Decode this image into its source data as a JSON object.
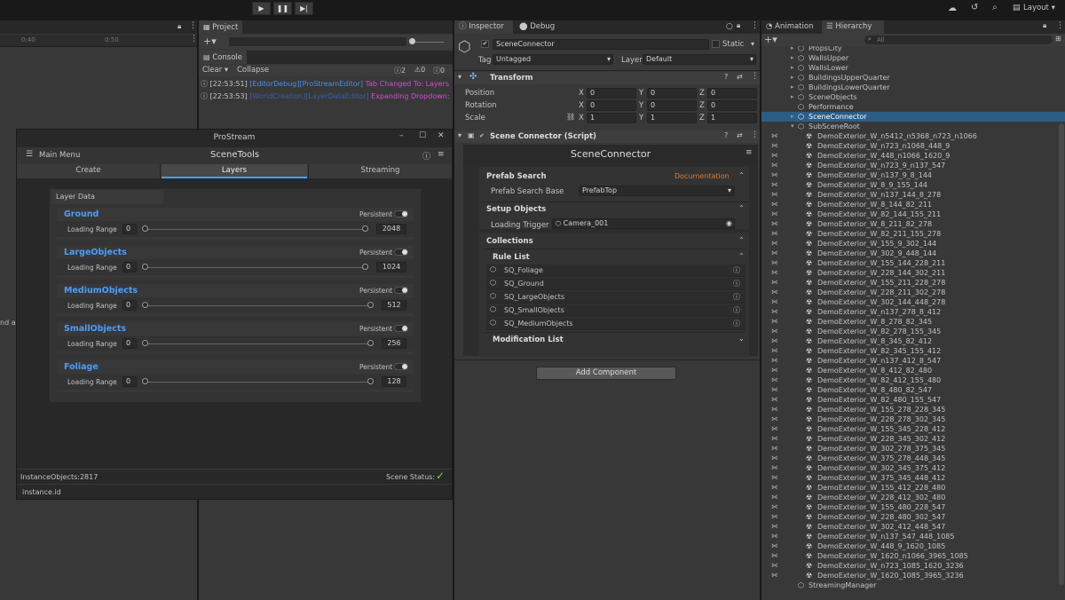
{
  "toolbar": {
    "play": "▶",
    "pause": "❚❚",
    "step": "▶|",
    "layout": "Layout"
  },
  "timeline": {
    "t1": "0:40",
    "t2": "0:50"
  },
  "left_edge_text": "nd a",
  "project": {
    "tab": "Project"
  },
  "console": {
    "tab": "Console",
    "clear": "Clear",
    "collapse": "Collapse",
    "count_info": "2",
    "count_warn": "0",
    "count_err": "0",
    "logs": [
      {
        "time": "[22:53:51]",
        "src": "[EditorDebug][ProStreamEditor]",
        "msg": "Tab Changed To: Layers"
      },
      {
        "time": "[22:53:53]",
        "src": "[WorldCreation][LayerDataEditor]",
        "msg": "Expanding Dropdown:"
      }
    ]
  },
  "inspector": {
    "tab": "Inspector",
    "debug_tab": "Debug",
    "object_name": "SceneConnector",
    "static_label": "Static",
    "tag_label": "Tag",
    "tag_value": "Untagged",
    "layer_label": "Layer",
    "layer_value": "Default",
    "transform": {
      "title": "Transform",
      "rows": [
        {
          "label": "Position",
          "x": "0",
          "y": "0",
          "z": "0"
        },
        {
          "label": "Rotation",
          "x": "0",
          "y": "0",
          "z": "0"
        },
        {
          "label": "Scale",
          "x": "1",
          "y": "1",
          "z": "1"
        }
      ]
    },
    "script": {
      "title": "Scene Connector (Script)",
      "header": "SceneConnector",
      "prefab_search": "Prefab Search",
      "documentation": "Documentation",
      "prefab_search_base_label": "Prefab Search Base",
      "prefab_search_base_value": "PrefabTop",
      "setup_objects": "Setup Objects",
      "loading_trigger_label": "Loading Trigger",
      "loading_trigger_value": "Camera_001",
      "collections": "Collections",
      "rule_list": "Rule List",
      "rules": [
        "SQ_Foliage",
        "SQ_Ground",
        "SQ_LargeObjects",
        "SQ_SmallObjects",
        "SQ_MediumObjects"
      ],
      "modification_list": "Modification List"
    },
    "add_component": "Add Component"
  },
  "animation": {
    "tab": "Animation"
  },
  "hierarchy": {
    "tab": "Hierarchy",
    "search_placeholder": "All",
    "top_items": [
      "PropsCity",
      "WallsUpper",
      "WallsLower",
      "BuildingsUpperQuarter",
      "BuildingsLowerQuarter",
      "SceneObjects",
      "Performance",
      "SceneConnector",
      "SubSceneRoot"
    ],
    "selected": "SceneConnector",
    "children": [
      "DemoExterior_W_n5412_n5368_n723_n1066",
      "DemoExterior_W_n723_n1068_448_9",
      "DemoExterior_W_448_n1066_1620_9",
      "DemoExterior_W_n723_9_n137_547",
      "DemoExterior_W_n137_9_8_144",
      "DemoExterior_W_8_9_155_144",
      "DemoExterior_W_n137_144_8_278",
      "DemoExterior_W_8_144_82_211",
      "DemoExterior_W_82_144_155_211",
      "DemoExterior_W_8_211_82_278",
      "DemoExterior_W_82_211_155_278",
      "DemoExterior_W_155_9_302_144",
      "DemoExterior_W_302_9_448_144",
      "DemoExterior_W_155_144_228_211",
      "DemoExterior_W_228_144_302_211",
      "DemoExterior_W_155_211_228_278",
      "DemoExterior_W_228_211_302_278",
      "DemoExterior_W_302_144_448_278",
      "DemoExterior_W_n137_278_8_412",
      "DemoExterior_W_8_278_82_345",
      "DemoExterior_W_82_278_155_345",
      "DemoExterior_W_8_345_82_412",
      "DemoExterior_W_82_345_155_412",
      "DemoExterior_W_n137_412_8_547",
      "DemoExterior_W_8_412_82_480",
      "DemoExterior_W_82_412_155_480",
      "DemoExterior_W_8_480_82_547",
      "DemoExterior_W_82_480_155_547",
      "DemoExterior_W_155_278_228_345",
      "DemoExterior_W_228_278_302_345",
      "DemoExterior_W_155_345_228_412",
      "DemoExterior_W_228_345_302_412",
      "DemoExterior_W_302_278_375_345",
      "DemoExterior_W_375_278_448_345",
      "DemoExterior_W_302_345_375_412",
      "DemoExterior_W_375_345_448_412",
      "DemoExterior_W_155_412_228_480",
      "DemoExterior_W_228_412_302_480",
      "DemoExterior_W_155_480_228_547",
      "DemoExterior_W_228_480_302_547",
      "DemoExterior_W_302_412_448_547",
      "DemoExterior_W_n137_547_448_1085",
      "DemoExterior_W_448_9_1620_1085",
      "DemoExterior_W_1620_n1066_3965_1085",
      "DemoExterior_W_n723_1085_1620_3236",
      "DemoExterior_W_1620_1085_3965_3236"
    ],
    "last_item": "StreamingManager"
  },
  "prostream": {
    "title": "ProStream",
    "main_menu": "Main Menu",
    "header": "SceneTools",
    "tabs": [
      "Create",
      "Layers",
      "Streaming"
    ],
    "active_tab": "Layers",
    "layer_data": "Layer Data",
    "persistent_label": "Persistent",
    "loading_range_label": "Loading Range",
    "layers": [
      {
        "name": "Ground",
        "min": "0",
        "max": "2048",
        "fill": 1.0
      },
      {
        "name": "LargeObjects",
        "min": "0",
        "max": "1024",
        "fill": 1.0
      },
      {
        "name": "MediumObjects",
        "min": "0",
        "max": "512",
        "fill": 1.0
      },
      {
        "name": "SmallObjects",
        "min": "0",
        "max": "256",
        "fill": 1.0
      },
      {
        "name": "Foliage",
        "min": "0",
        "max": "128",
        "fill": 1.0
      }
    ],
    "instance_objects": "InstanceObjects:2817",
    "scene_status": "Scene Status:",
    "instance_id": "instance.id"
  },
  "colors": {
    "accent_blue": "#4a9eff",
    "link_blue": "#4d8fe0",
    "magenta": "#d24fd2",
    "orange": "#e07b2a",
    "selection": "#2c5d87",
    "check_green": "#7fd04a"
  }
}
